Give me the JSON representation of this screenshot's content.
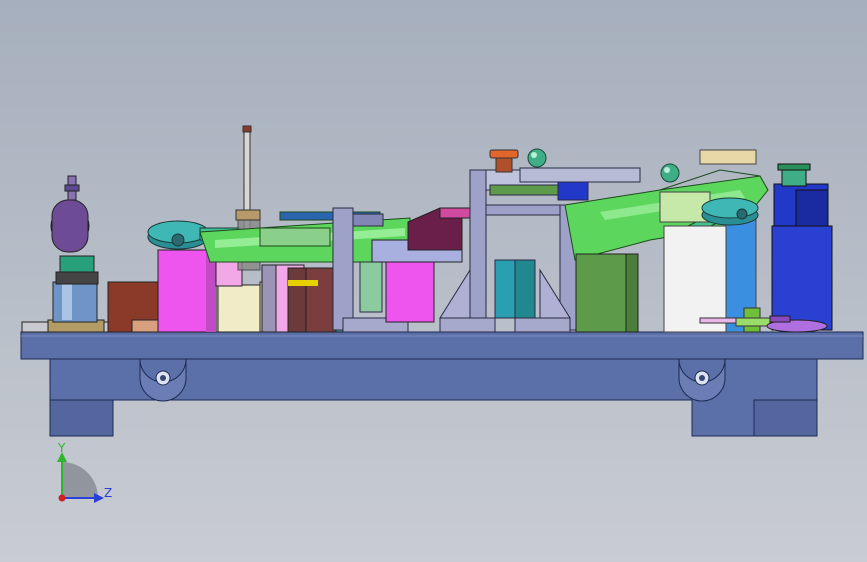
{
  "triad": {
    "y_label": "Y",
    "z_label": "Z",
    "colors": {
      "y_axis": "#2fb52f",
      "z_axis": "#2a3fd8",
      "origin": "#d02020"
    }
  },
  "palette": {
    "base": "#5b6fa8",
    "magenta": "#ee55ee",
    "green": "#5dd65d",
    "cyan": "#2a9fb2",
    "blue": "#2238c8",
    "olive": "#5d9b4a",
    "brown": "#8b3a2a",
    "orange": "#e2662c"
  }
}
